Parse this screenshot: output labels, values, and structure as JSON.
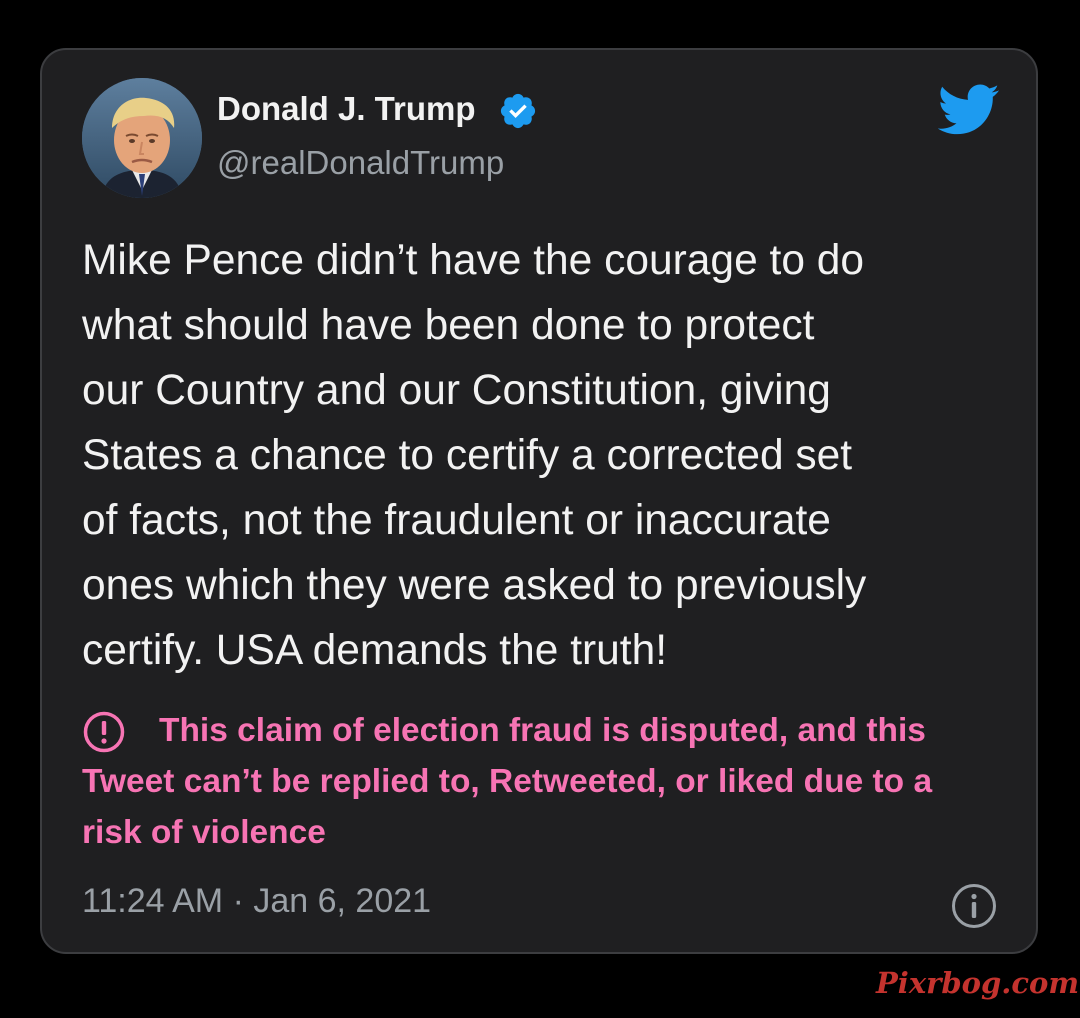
{
  "tweet": {
    "author_name": "Donald J. Trump",
    "author_handle": "@realDonaldTrump",
    "verified": true,
    "avatar_icon": "profile-photo",
    "logo_icon": "twitter-bird-icon",
    "text": "Mike Pence didn’t have the courage to do\nwhat should have been done to protect\nour Country and our Constitution, giving\nStates a chance to certify a corrected set\nof facts, not the fraudulent or inaccurate\nones which they were asked to previously\ncertify. USA demands the truth!",
    "notice": "This claim of election fraud is disputed, and this Tweet can’t be replied to, Retweeted, or liked due to a risk of violence",
    "notice_icon": "alert-circle-icon",
    "timestamp": "11:24 AM · Jan 6, 2021",
    "info_icon": "info-icon"
  },
  "watermark": "Pixrbog.com",
  "colors": {
    "background": "#000000",
    "card": "#1f1f21",
    "card_border": "#3c3d40",
    "text": "#f2f2f2",
    "secondary_text": "#9aa0a6",
    "notice": "#f774b4",
    "twitter_blue": "#1d9bf0",
    "watermark": "#c4332e"
  }
}
